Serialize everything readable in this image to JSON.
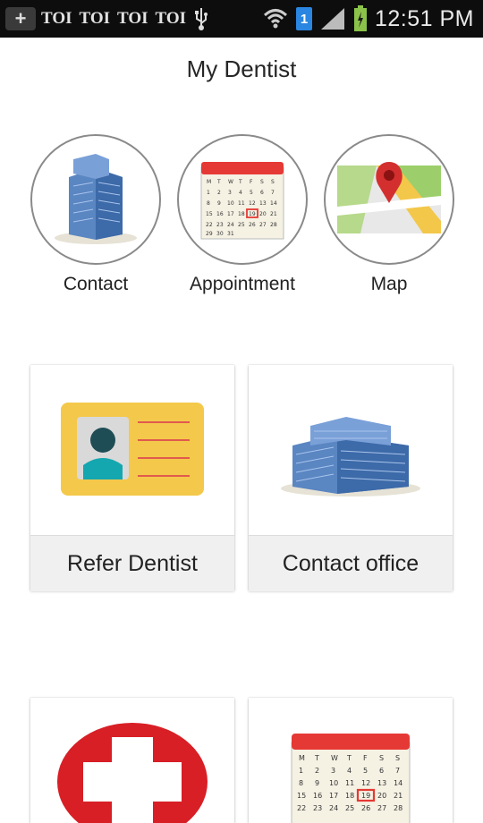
{
  "status_bar": {
    "notification_texts": [
      "TOI",
      "TOI",
      "TOI",
      "TOI"
    ],
    "network_badge": "1",
    "time": "12:51 PM"
  },
  "header": {
    "title": "My Dentist"
  },
  "top_actions": [
    {
      "label": "Contact",
      "icon": "building-icon"
    },
    {
      "label": "Appointment",
      "icon": "calendar-icon"
    },
    {
      "label": "Map",
      "icon": "map-pin-icon"
    }
  ],
  "cards": [
    {
      "label": "Refer Dentist",
      "icon": "id-card-icon"
    },
    {
      "label": "Contact office",
      "icon": "building-icon"
    },
    {
      "label": "",
      "icon": "medical-cross-icon"
    },
    {
      "label": "",
      "icon": "calendar-icon"
    }
  ],
  "calendar": {
    "days_header": [
      "M",
      "T",
      "W",
      "T",
      "F",
      "S",
      "S"
    ],
    "numbers": [
      "1",
      "2",
      "3",
      "4",
      "5",
      "6",
      "7",
      "8",
      "9",
      "10",
      "11",
      "12",
      "13",
      "14",
      "15",
      "16",
      "17",
      "18",
      "19",
      "20",
      "21",
      "22",
      "23",
      "24",
      "25",
      "26",
      "27",
      "28",
      "29",
      "30",
      "31"
    ],
    "highlight": "19"
  },
  "colors": {
    "calendar_red": "#e53935",
    "id_card_yellow": "#f4c84a",
    "cross_red": "#d81f26"
  }
}
